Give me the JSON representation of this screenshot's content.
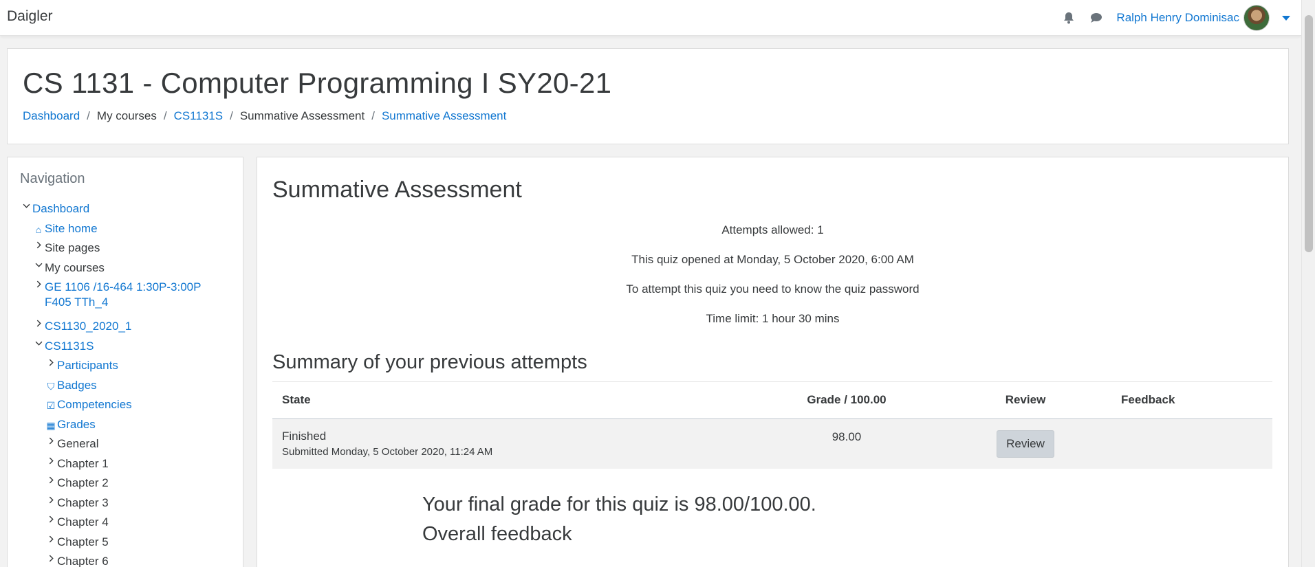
{
  "navbar": {
    "brand": "Daigler",
    "user_name": "Ralph Henry Dominisac",
    "icons": [
      "bell-icon",
      "chat-icon"
    ]
  },
  "header": {
    "course_title": "CS 1131 - Computer Programming I SY20-21",
    "breadcrumb": [
      {
        "label": "Dashboard",
        "link": true
      },
      {
        "label": "My courses",
        "link": false
      },
      {
        "label": "CS1131S",
        "link": true
      },
      {
        "label": "Summative Assessment",
        "link": false
      },
      {
        "label": "Summative Assessment",
        "link": true
      }
    ]
  },
  "navigation": {
    "heading": "Navigation",
    "items": [
      {
        "label": "Dashboard",
        "link": true,
        "indent": 0,
        "chevron": "down",
        "icon": ""
      },
      {
        "label": "Site home",
        "link": true,
        "indent": 1,
        "chevron": "",
        "icon": "home-icon"
      },
      {
        "label": "Site pages",
        "link": false,
        "indent": 1,
        "chevron": "right",
        "icon": ""
      },
      {
        "label": "My courses",
        "link": false,
        "indent": 1,
        "chevron": "down",
        "icon": ""
      },
      {
        "label": "GE 1106 /16-464 1:30P-3:00P F405 TTh_4",
        "link": true,
        "indent": 2,
        "chevron": "right",
        "icon": ""
      },
      {
        "label": "CS1130_2020_1",
        "link": true,
        "indent": 2,
        "chevron": "right",
        "icon": ""
      },
      {
        "label": "CS1131S",
        "link": true,
        "indent": 2,
        "chevron": "down",
        "icon": ""
      },
      {
        "label": "Participants",
        "link": true,
        "indent": 3,
        "chevron": "right",
        "icon": ""
      },
      {
        "label": "Badges",
        "link": true,
        "indent": 3,
        "chevron": "",
        "icon": "shield-icon"
      },
      {
        "label": "Competencies",
        "link": true,
        "indent": 3,
        "chevron": "",
        "icon": "checkbox-icon"
      },
      {
        "label": "Grades",
        "link": true,
        "indent": 3,
        "chevron": "",
        "icon": "table-icon"
      },
      {
        "label": "General",
        "link": false,
        "indent": 3,
        "chevron": "right",
        "icon": ""
      },
      {
        "label": "Chapter 1",
        "link": false,
        "indent": 3,
        "chevron": "right",
        "icon": ""
      },
      {
        "label": "Chapter 2",
        "link": false,
        "indent": 3,
        "chevron": "right",
        "icon": ""
      },
      {
        "label": "Chapter 3",
        "link": false,
        "indent": 3,
        "chevron": "right",
        "icon": ""
      },
      {
        "label": "Chapter 4",
        "link": false,
        "indent": 3,
        "chevron": "right",
        "icon": ""
      },
      {
        "label": "Chapter 5",
        "link": false,
        "indent": 3,
        "chevron": "right",
        "icon": ""
      },
      {
        "label": "Chapter 6",
        "link": false,
        "indent": 3,
        "chevron": "right",
        "icon": ""
      }
    ]
  },
  "quiz": {
    "title": "Summative Assessment",
    "info": [
      "Attempts allowed: 1",
      "This quiz opened at Monday, 5 October 2020, 6:00 AM",
      "To attempt this quiz you need to know the quiz password",
      "Time limit: 1 hour 30 mins"
    ],
    "summary_title": "Summary of your previous attempts",
    "table": {
      "headers": {
        "state": "State",
        "grade": "Grade / 100.00",
        "review": "Review",
        "feedback": "Feedback"
      },
      "rows": [
        {
          "state": "Finished",
          "submitted": "Submitted Monday, 5 October 2020, 11:24 AM",
          "grade": "98.00",
          "review_label": "Review",
          "feedback": ""
        }
      ]
    },
    "final_grade": "Your final grade for this quiz is 98.00/100.00.",
    "overall_feedback": "Overall feedback"
  },
  "colors": {
    "link": "#1177d1",
    "text": "#373a3c",
    "page_bg": "#f2f2f2",
    "button_bg": "#ced4da"
  }
}
